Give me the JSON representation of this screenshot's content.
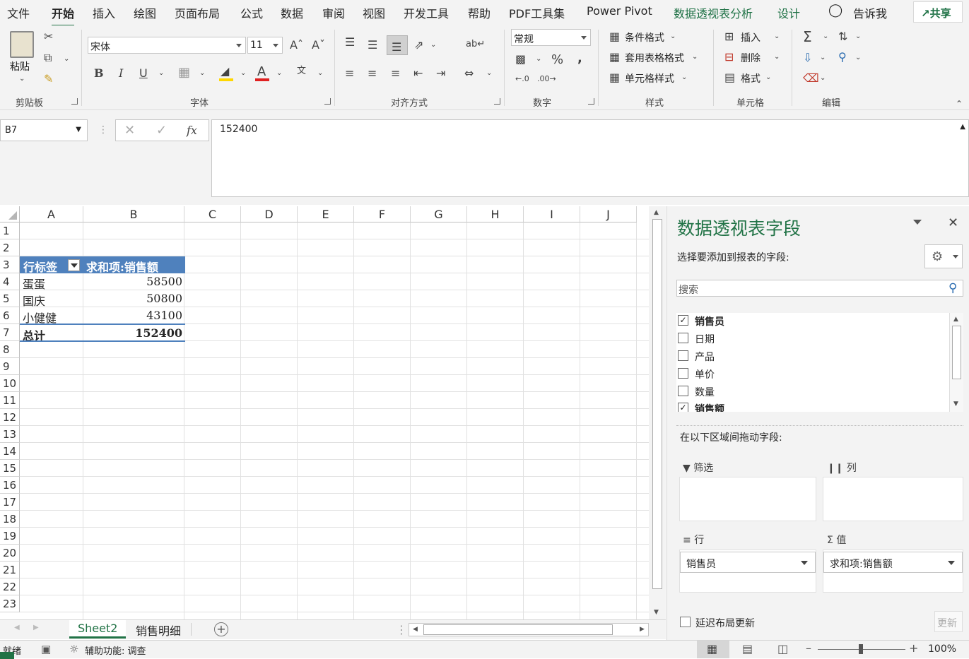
{
  "menu": {
    "tabs": [
      "文件",
      "开始",
      "插入",
      "绘图",
      "页面布局",
      "公式",
      "数据",
      "审阅",
      "视图",
      "开发工具",
      "帮助",
      "PDF工具集",
      "Power Pivot",
      "数据透视表分析",
      "设计"
    ],
    "tell_me": "告诉我",
    "share": "共享"
  },
  "ribbon": {
    "clipboard": {
      "paste": "粘贴",
      "label": "剪贴板"
    },
    "font": {
      "name": "宋体",
      "size": "11",
      "label": "字体",
      "bold": "B",
      "italic": "I",
      "underline": "U"
    },
    "alignment": {
      "label": "对齐方式"
    },
    "number": {
      "format": "常规",
      "label": "数字",
      "percent": "%",
      "comma": ","
    },
    "styles": {
      "conditional": "条件格式",
      "table": "套用表格格式",
      "cell": "单元格样式",
      "label": "样式"
    },
    "cells": {
      "insert": "插入",
      "delete": "删除",
      "format": "格式",
      "label": "单元格"
    },
    "editing": {
      "label": "编辑"
    }
  },
  "formula_bar": {
    "name_box": "B7",
    "fx": "fx",
    "value": "152400"
  },
  "grid": {
    "columns": [
      "A",
      "B",
      "C",
      "D",
      "E",
      "F",
      "G",
      "H",
      "I",
      "J"
    ],
    "rows": [
      "1",
      "2",
      "3",
      "4",
      "5",
      "6",
      "7",
      "8",
      "9",
      "10",
      "11",
      "12",
      "13",
      "14",
      "15",
      "16",
      "17",
      "18",
      "19",
      "20",
      "21",
      "22",
      "23"
    ],
    "pivot": {
      "header_label": "行标签",
      "header_value": "求和项:销售额",
      "rows": [
        {
          "label": "蛋蛋",
          "value": "58500"
        },
        {
          "label": "国庆",
          "value": "50800"
        },
        {
          "label": "小健健",
          "value": "43100"
        }
      ],
      "total_label": "总计",
      "total_value": "152400"
    }
  },
  "sheets": {
    "tabs": [
      "Sheet2",
      "销售明细"
    ],
    "active": "Sheet2"
  },
  "pane": {
    "title": "数据透视表字段",
    "choose_label": "选择要添加到报表的字段:",
    "search_placeholder": "搜索",
    "fields": [
      {
        "name": "销售员",
        "checked": true
      },
      {
        "name": "日期",
        "checked": false
      },
      {
        "name": "产品",
        "checked": false
      },
      {
        "name": "单价",
        "checked": false
      },
      {
        "name": "数量",
        "checked": false
      },
      {
        "name": "销售额",
        "checked": true
      }
    ],
    "drag_label": "在以下区域间拖动字段:",
    "zones": {
      "filter": "筛选",
      "columns": "列",
      "rows": "行",
      "values": "值",
      "rows_item": "销售员",
      "values_item": "求和项:销售额"
    },
    "defer_label": "延迟布局更新",
    "update_button": "更新"
  },
  "status": {
    "ready": "就绪",
    "accessibility": "辅助功能: 调查",
    "zoom": "100%"
  },
  "colors": {
    "accent": "#217346",
    "pivot_header": "#4f81bd",
    "context_tab": "#1e7145"
  }
}
